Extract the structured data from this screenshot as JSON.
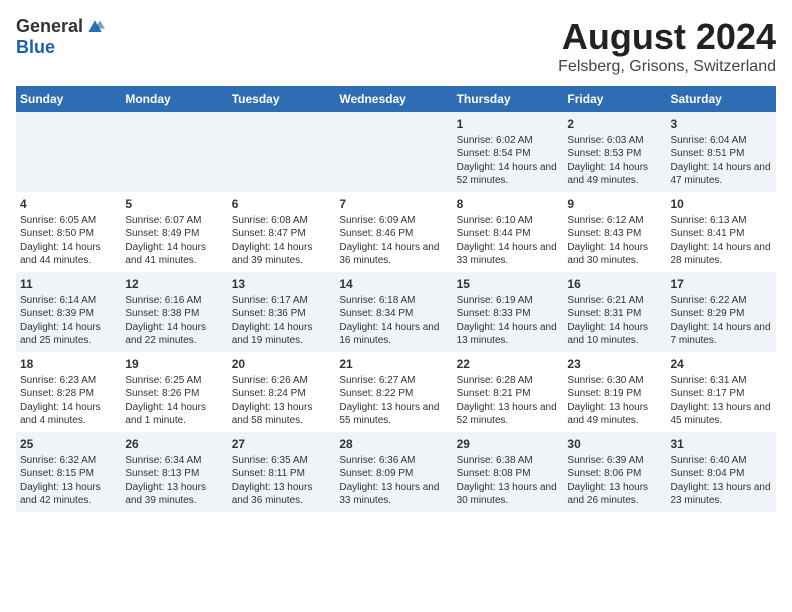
{
  "header": {
    "logo_general": "General",
    "logo_blue": "Blue",
    "month": "August 2024",
    "location": "Felsberg, Grisons, Switzerland"
  },
  "weekdays": [
    "Sunday",
    "Monday",
    "Tuesday",
    "Wednesday",
    "Thursday",
    "Friday",
    "Saturday"
  ],
  "weeks": [
    [
      {
        "day": "",
        "info": ""
      },
      {
        "day": "",
        "info": ""
      },
      {
        "day": "",
        "info": ""
      },
      {
        "day": "",
        "info": ""
      },
      {
        "day": "1",
        "info": "Sunrise: 6:02 AM\nSunset: 8:54 PM\nDaylight: 14 hours and 52 minutes."
      },
      {
        "day": "2",
        "info": "Sunrise: 6:03 AM\nSunset: 8:53 PM\nDaylight: 14 hours and 49 minutes."
      },
      {
        "day": "3",
        "info": "Sunrise: 6:04 AM\nSunset: 8:51 PM\nDaylight: 14 hours and 47 minutes."
      }
    ],
    [
      {
        "day": "4",
        "info": "Sunrise: 6:05 AM\nSunset: 8:50 PM\nDaylight: 14 hours and 44 minutes."
      },
      {
        "day": "5",
        "info": "Sunrise: 6:07 AM\nSunset: 8:49 PM\nDaylight: 14 hours and 41 minutes."
      },
      {
        "day": "6",
        "info": "Sunrise: 6:08 AM\nSunset: 8:47 PM\nDaylight: 14 hours and 39 minutes."
      },
      {
        "day": "7",
        "info": "Sunrise: 6:09 AM\nSunset: 8:46 PM\nDaylight: 14 hours and 36 minutes."
      },
      {
        "day": "8",
        "info": "Sunrise: 6:10 AM\nSunset: 8:44 PM\nDaylight: 14 hours and 33 minutes."
      },
      {
        "day": "9",
        "info": "Sunrise: 6:12 AM\nSunset: 8:43 PM\nDaylight: 14 hours and 30 minutes."
      },
      {
        "day": "10",
        "info": "Sunrise: 6:13 AM\nSunset: 8:41 PM\nDaylight: 14 hours and 28 minutes."
      }
    ],
    [
      {
        "day": "11",
        "info": "Sunrise: 6:14 AM\nSunset: 8:39 PM\nDaylight: 14 hours and 25 minutes."
      },
      {
        "day": "12",
        "info": "Sunrise: 6:16 AM\nSunset: 8:38 PM\nDaylight: 14 hours and 22 minutes."
      },
      {
        "day": "13",
        "info": "Sunrise: 6:17 AM\nSunset: 8:36 PM\nDaylight: 14 hours and 19 minutes."
      },
      {
        "day": "14",
        "info": "Sunrise: 6:18 AM\nSunset: 8:34 PM\nDaylight: 14 hours and 16 minutes."
      },
      {
        "day": "15",
        "info": "Sunrise: 6:19 AM\nSunset: 8:33 PM\nDaylight: 14 hours and 13 minutes."
      },
      {
        "day": "16",
        "info": "Sunrise: 6:21 AM\nSunset: 8:31 PM\nDaylight: 14 hours and 10 minutes."
      },
      {
        "day": "17",
        "info": "Sunrise: 6:22 AM\nSunset: 8:29 PM\nDaylight: 14 hours and 7 minutes."
      }
    ],
    [
      {
        "day": "18",
        "info": "Sunrise: 6:23 AM\nSunset: 8:28 PM\nDaylight: 14 hours and 4 minutes."
      },
      {
        "day": "19",
        "info": "Sunrise: 6:25 AM\nSunset: 8:26 PM\nDaylight: 14 hours and 1 minute."
      },
      {
        "day": "20",
        "info": "Sunrise: 6:26 AM\nSunset: 8:24 PM\nDaylight: 13 hours and 58 minutes."
      },
      {
        "day": "21",
        "info": "Sunrise: 6:27 AM\nSunset: 8:22 PM\nDaylight: 13 hours and 55 minutes."
      },
      {
        "day": "22",
        "info": "Sunrise: 6:28 AM\nSunset: 8:21 PM\nDaylight: 13 hours and 52 minutes."
      },
      {
        "day": "23",
        "info": "Sunrise: 6:30 AM\nSunset: 8:19 PM\nDaylight: 13 hours and 49 minutes."
      },
      {
        "day": "24",
        "info": "Sunrise: 6:31 AM\nSunset: 8:17 PM\nDaylight: 13 hours and 45 minutes."
      }
    ],
    [
      {
        "day": "25",
        "info": "Sunrise: 6:32 AM\nSunset: 8:15 PM\nDaylight: 13 hours and 42 minutes."
      },
      {
        "day": "26",
        "info": "Sunrise: 6:34 AM\nSunset: 8:13 PM\nDaylight: 13 hours and 39 minutes."
      },
      {
        "day": "27",
        "info": "Sunrise: 6:35 AM\nSunset: 8:11 PM\nDaylight: 13 hours and 36 minutes."
      },
      {
        "day": "28",
        "info": "Sunrise: 6:36 AM\nSunset: 8:09 PM\nDaylight: 13 hours and 33 minutes."
      },
      {
        "day": "29",
        "info": "Sunrise: 6:38 AM\nSunset: 8:08 PM\nDaylight: 13 hours and 30 minutes."
      },
      {
        "day": "30",
        "info": "Sunrise: 6:39 AM\nSunset: 8:06 PM\nDaylight: 13 hours and 26 minutes."
      },
      {
        "day": "31",
        "info": "Sunrise: 6:40 AM\nSunset: 8:04 PM\nDaylight: 13 hours and 23 minutes."
      }
    ]
  ]
}
